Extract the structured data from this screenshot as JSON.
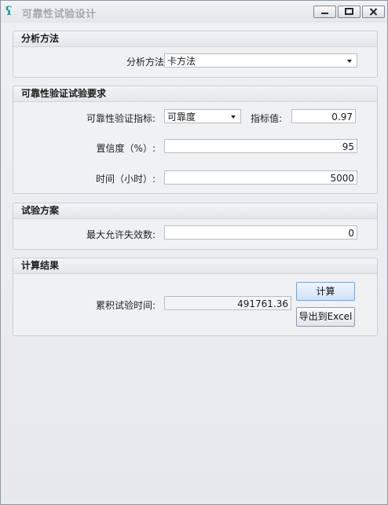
{
  "window": {
    "title": "可靠性试验设计",
    "icon": "app-logo-icon"
  },
  "analysis_method": {
    "section_title": "分析方法",
    "method_label": "分析方法:",
    "method_value": "卡方法"
  },
  "reliability_requirements": {
    "section_title": "可靠性验证试验要求",
    "index_label": "可靠性验证指标:",
    "index_value": "可靠度",
    "index_value_label": "指标值:",
    "index_value_number": "0.97",
    "confidence_label": "置信度（%）:",
    "confidence_value": "95",
    "time_label": "时间（小时）:",
    "time_value": "5000"
  },
  "test_plan": {
    "section_title": "试验方案",
    "max_failures_label": "最大允许失效数:",
    "max_failures_value": "0"
  },
  "results": {
    "section_title": "计算结果",
    "cumulative_time_label": "累积试验时间:",
    "cumulative_time_value": "491761.36",
    "calculate_button": "计算",
    "export_button": "导出到Excel"
  }
}
